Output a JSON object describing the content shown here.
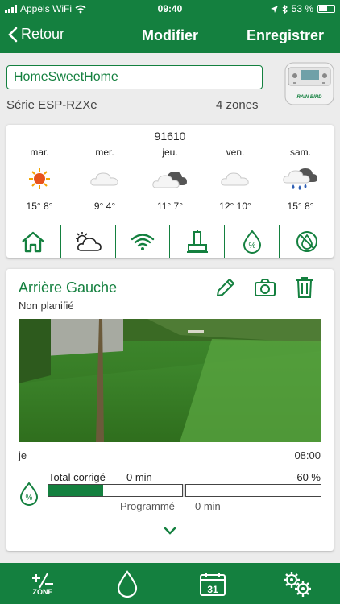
{
  "status_bar": {
    "carrier": "Appels WiFi",
    "time": "09:40",
    "battery_text": "53 %",
    "battery_level": 0.53
  },
  "nav": {
    "back_label": "Retour",
    "title": "Modifier",
    "save_label": "Enregistrer"
  },
  "controller": {
    "name": "HomeSweetHome",
    "series": "Série ESP-RZXe",
    "zone_count": "4 zones",
    "brand_logo": "RAIN BIRD"
  },
  "weather": {
    "location": "91610",
    "days": [
      {
        "name": "mar.",
        "icon": "sun-icon",
        "temps": "15° 8°"
      },
      {
        "name": "mer.",
        "icon": "cloud-icon",
        "temps": "9° 4°"
      },
      {
        "name": "jeu.",
        "icon": "cloud-dark-icon",
        "temps": "11° 7°"
      },
      {
        "name": "ven.",
        "icon": "cloud-icon",
        "temps": "12° 10°"
      },
      {
        "name": "sam.",
        "icon": "rain-cloud-icon",
        "temps": "15° 8°"
      }
    ],
    "tabs": [
      {
        "name": "home-icon",
        "selected": false
      },
      {
        "name": "sun-cloud-icon",
        "selected": true
      },
      {
        "name": "wifi-icon",
        "selected": false
      },
      {
        "name": "controller-icon",
        "selected": false
      },
      {
        "name": "percent-drop-icon",
        "selected": false
      },
      {
        "name": "no-water-icon",
        "selected": false
      }
    ]
  },
  "zone": {
    "name": "Arrière Gauche",
    "status": "Non planifié",
    "day": "je",
    "time": "08:00",
    "total_label": "Total corrigé",
    "total_minutes": "0 min",
    "adjust_percent": "-60 %",
    "adjust_fill_fraction": 0.2,
    "programmed_label": "Programmé",
    "programmed_minutes": "0 min"
  },
  "toolbar": {
    "items": [
      {
        "icon": "plus-minus-icon",
        "label": "ZONE"
      },
      {
        "icon": "water-drop-icon"
      },
      {
        "icon": "calendar-icon",
        "label": "31"
      },
      {
        "icon": "gears-icon"
      }
    ]
  },
  "colors": {
    "brand_green": "#14803f",
    "background": "#ececec",
    "card": "#ffffff"
  }
}
